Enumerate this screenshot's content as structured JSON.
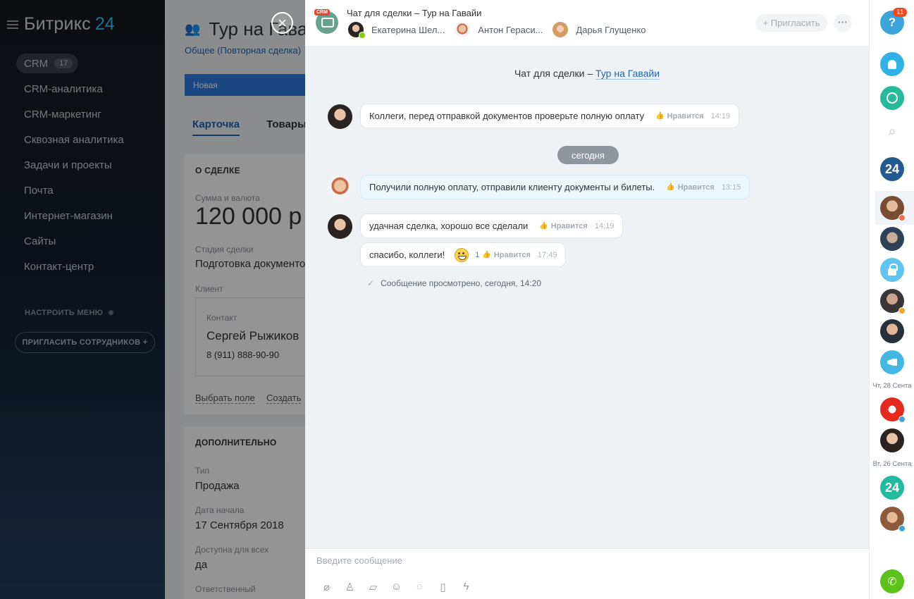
{
  "sidebar": {
    "logo_text": "Битрикс",
    "logo_num": "24",
    "items": [
      {
        "label": "CRM",
        "badge": "17"
      },
      {
        "label": "CRM-аналитика"
      },
      {
        "label": "CRM-маркетинг"
      },
      {
        "label": "Сквозная аналитика"
      },
      {
        "label": "Задачи и проекты"
      },
      {
        "label": "Почта"
      },
      {
        "label": "Интернет-магазин"
      },
      {
        "label": "Сайты"
      },
      {
        "label": "Контакт-центр"
      }
    ],
    "configure_menu": "НАСТРОИТЬ МЕНЮ",
    "invite_employees": "ПРИГЛАСИТЬ СОТРУДНИКОВ +"
  },
  "deal": {
    "title": "Тур на Гавайи",
    "breadcrumb": "Общее (Повторная сделка)",
    "stage": "Новая",
    "tabs": [
      "Карточка",
      "Товары"
    ],
    "section_about": "О СДЕЛКЕ",
    "amount_label": "Сумма и валюта",
    "amount_value": "120 000 р",
    "stage_label": "Стадия сделки",
    "stage_value": "Подготовка документов",
    "client_label": "Клиент",
    "contact_label": "Контакт",
    "contact_name": "Сергей Рыжиков",
    "contact_phone": "8 (911) 888-90-90",
    "choose_field": "Выбрать поле",
    "create_field": "Создать",
    "section_extra": "ДОПОЛНИТЕЛЬНО",
    "type_label": "Тип",
    "type_value": "Продажа",
    "start_label": "Дата начала",
    "start_value": "17 Сентября 2018",
    "access_label": "Доступна для всех",
    "access_value": "да",
    "responsible_label": "Ответственный"
  },
  "chat": {
    "crm_tag": "CRM",
    "title": "Чат для сделки – Тур на Гавайи",
    "members": [
      {
        "name": "Екатерина Шел..."
      },
      {
        "name": "Антон Гераси..."
      },
      {
        "name": "Дарья Глущенко"
      }
    ],
    "invite_label": "+ Пригласить",
    "more_label": "···",
    "caption_prefix": "Чат для сделки – ",
    "caption_link": "Тур на Гавайи",
    "date_separator": "сегодня",
    "like_label": "Нравится",
    "messages": [
      {
        "text": "Коллеги, перед отправкой документов проверьте полную оплату",
        "time": "14:19"
      },
      {
        "text": "Получили полную оплату, отправили клиенту документы и билеты.",
        "time": "13:15"
      },
      {
        "text": "удачная сделка, хорошо все сделали",
        "time": "14:19"
      },
      {
        "text": "спасибо, коллеги!",
        "time": "17:49",
        "likes": "1"
      }
    ],
    "read_status": "Сообщение просмотрено, сегодня, 14:20",
    "input_placeholder": "Введите сообщение"
  },
  "rightbar": {
    "help_symbol": "?",
    "help_count": "11",
    "logo_24": "24",
    "date_1": "Чт, 28 Сента",
    "date_2": "Вт, 26 Сента"
  }
}
